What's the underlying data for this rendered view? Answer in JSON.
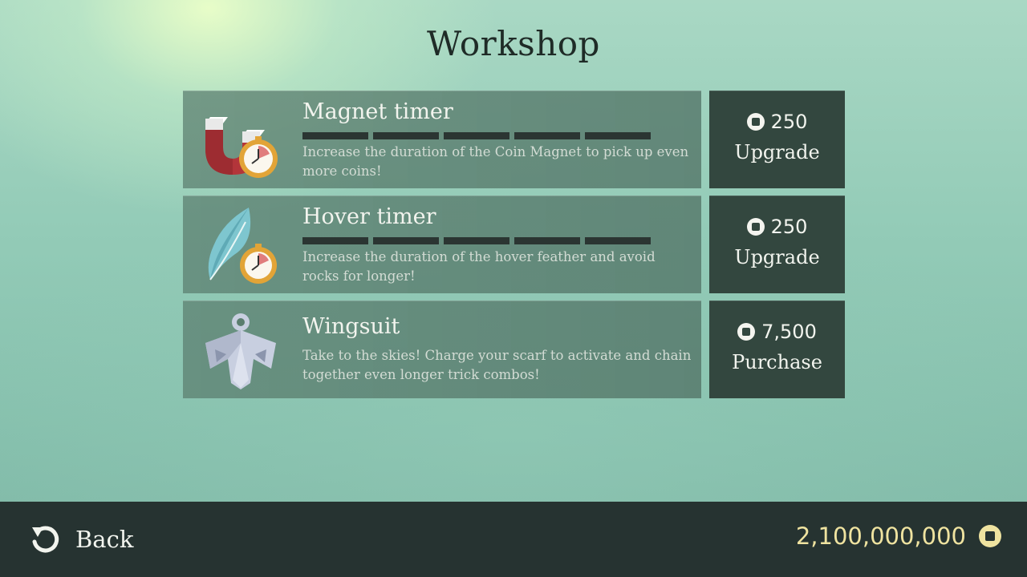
{
  "title": "Workshop",
  "items": [
    {
      "name": "Magnet timer",
      "description": "Increase the duration of the Coin Magnet to pick up even more coins!",
      "upgrade_levels": 5,
      "price": "250",
      "action": "Upgrade",
      "icon": "magnet-timer-icon"
    },
    {
      "name": "Hover timer",
      "description": "Increase the duration of the hover feather and avoid rocks for longer!",
      "upgrade_levels": 5,
      "price": "250",
      "action": "Upgrade",
      "icon": "feather-timer-icon"
    },
    {
      "name": "Wingsuit",
      "description": "Take to the skies! Charge your scarf to activate and chain together even longer trick combos!",
      "price": "7,500",
      "action": "Purchase",
      "icon": "wingsuit-icon"
    }
  ],
  "footer": {
    "back_label": "Back",
    "balance": "2,100,000,000"
  },
  "colors": {
    "card": "#5a7d6e",
    "button": "#33473f",
    "footer": "#263331",
    "coin_gold": "#efe3a0"
  }
}
